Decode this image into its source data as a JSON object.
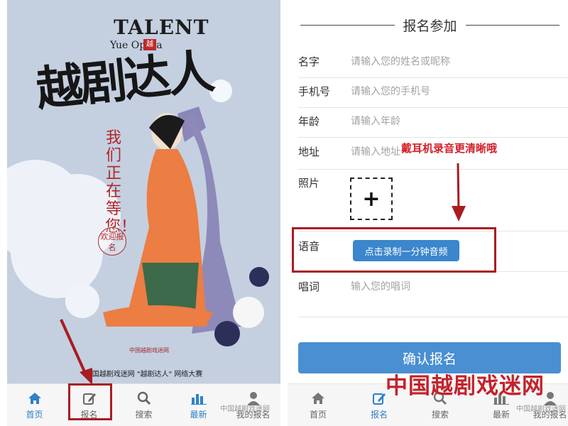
{
  "left": {
    "poster": {
      "title_en": "TALENT",
      "subtitle_en": "Yue Opera",
      "seal": "越",
      "title_cn": "越剧达人",
      "tagline": "我们正在等您！",
      "welcome": "欢迎报名",
      "org_text": "中国越剧戏迷网",
      "contest": "中国越剧戏迷网 \"越剧达人\" 网络大赛"
    },
    "tabbar": {
      "items": [
        {
          "label": "首页",
          "icon": "home-icon"
        },
        {
          "label": "报名",
          "icon": "edit-icon",
          "active": true
        },
        {
          "label": "搜索",
          "icon": "search-icon"
        },
        {
          "label": "最新",
          "icon": "bar-chart-icon"
        },
        {
          "label": "我的报名",
          "icon": "user-icon"
        }
      ],
      "watermark": "中国越剧戏迷网"
    }
  },
  "right": {
    "section_title": "报名参加",
    "fields": {
      "name": {
        "label": "名字",
        "placeholder": "请输入您的姓名或昵称"
      },
      "phone": {
        "label": "手机号",
        "placeholder": "请输入您的手机号"
      },
      "age": {
        "label": "年龄",
        "placeholder": "请输入年龄"
      },
      "address": {
        "label": "地址",
        "placeholder": "请输入地址"
      },
      "photo": {
        "label": "照片",
        "add_symbol": "+"
      },
      "voice": {
        "label": "语音",
        "button": "点击录制一分钟音频"
      },
      "lyrics": {
        "label": "唱词",
        "placeholder": "输入您的唱词"
      }
    },
    "annotation": "戴耳机录音更清晰哦",
    "confirm_label": "确认报名",
    "brand_watermark": "中国越剧戏迷网",
    "tabbar": {
      "items": [
        {
          "label": "首页",
          "icon": "home-icon"
        },
        {
          "label": "报名",
          "icon": "edit-icon",
          "active": true
        },
        {
          "label": "搜索",
          "icon": "search-icon"
        },
        {
          "label": "最新",
          "icon": "bar-chart-icon"
        },
        {
          "label": "我的报名",
          "icon": "user-icon"
        }
      ],
      "watermark": "中国越剧戏迷网"
    }
  },
  "colors": {
    "accent": "#3b86cc",
    "highlight": "#a81c22",
    "poster_bg": "#c4d0e0",
    "figure_orange": "#ec7d43"
  }
}
